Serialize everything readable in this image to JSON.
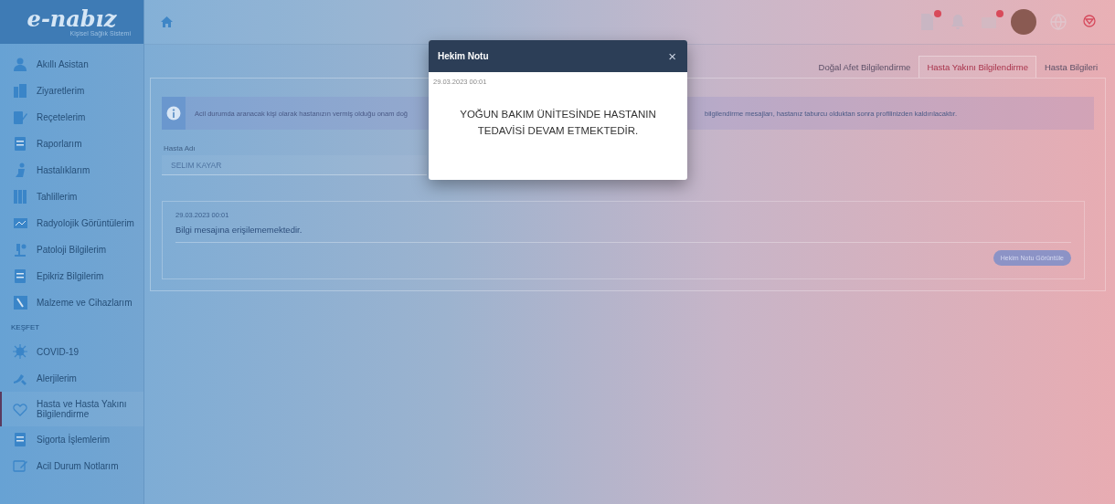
{
  "logo": {
    "name": "e-nabız",
    "tagline": "Kişisel Sağlık Sistemi"
  },
  "header": {
    "icons": [
      {
        "kind": "document",
        "badge": true
      },
      {
        "kind": "bell",
        "badge": false
      },
      {
        "kind": "mail",
        "badge": true
      },
      {
        "kind": "avatar",
        "badge": false
      },
      {
        "kind": "globe",
        "badge": false
      },
      {
        "kind": "emblem",
        "badge": false
      }
    ]
  },
  "sidebar": {
    "items": [
      {
        "label": "Akıllı Asistan",
        "selected": false
      },
      {
        "label": "Ziyaretlerim",
        "selected": false
      },
      {
        "label": "Reçetelerim",
        "selected": false
      },
      {
        "label": "Raporlarım",
        "selected": false
      },
      {
        "label": "Hastalıklarım",
        "selected": false
      },
      {
        "label": "Tahlillerim",
        "selected": false
      },
      {
        "label": "Radyolojik Görüntülerim",
        "selected": false
      },
      {
        "label": "Patoloji Bilgilerim",
        "selected": false
      },
      {
        "label": "Epikriz Bilgilerim",
        "selected": false
      },
      {
        "label": "Malzeme ve Cihazlarım",
        "selected": false
      }
    ],
    "section": "KEŞFET",
    "explore_items": [
      {
        "label": "COVID-19",
        "selected": false
      },
      {
        "label": "Alerjilerim",
        "selected": false
      },
      {
        "label": "Hasta ve Hasta Yakını Bilgilendirme",
        "selected": true
      },
      {
        "label": "Sigorta İşlemlerim",
        "selected": false
      },
      {
        "label": "Acil Durum Notlarım",
        "selected": false
      }
    ]
  },
  "tabs": [
    {
      "label": "Doğal Afet Bilgilendirme",
      "selected": false
    },
    {
      "label": "Hasta Yakını Bilgilendirme",
      "selected": true
    },
    {
      "label": "Hasta Bilgileri",
      "selected": false
    }
  ],
  "alert": {
    "text_start": "Acil durumda aranacak kişi olarak hastanızın vermiş olduğu onam doğ",
    "text_end": "bilgilendirme mesajları, hastanız taburcu olduktan sonra profilinizden kaldırılacaktır."
  },
  "patient_field": {
    "label": "Hasta Adı",
    "value": "SELIM KAYAR"
  },
  "message_card": {
    "date": "29.03.2023 00:01",
    "text": "Bilgi mesajına erişilememektedir.",
    "button": "Hekim Notu Görüntüle"
  },
  "modal": {
    "title": "Hekim Notu",
    "close": "×",
    "date": "29.03.2023 00:01",
    "body": "YOĞUN BAKIM ÜNİTESİNDE HASTANIN TEDAVİSİ DEVAM ETMEKTEDİR."
  }
}
